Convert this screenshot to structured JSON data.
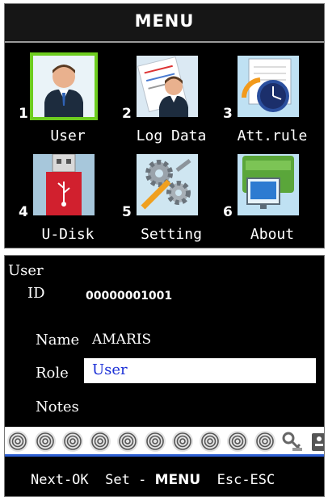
{
  "menu": {
    "title": "MENU",
    "items": [
      {
        "num": "1",
        "label": "User",
        "icon": "user-icon"
      },
      {
        "num": "2",
        "label": "Log Data",
        "icon": "log-data-icon"
      },
      {
        "num": "3",
        "label": "Att.rule",
        "icon": "attendance-rule-icon"
      },
      {
        "num": "4",
        "label": "U-Disk",
        "icon": "usb-disk-icon"
      },
      {
        "num": "5",
        "label": "Setting",
        "icon": "settings-gears-icon"
      },
      {
        "num": "6",
        "label": "About",
        "icon": "about-fingerprint-icon"
      }
    ],
    "selected_index": 0
  },
  "user_form": {
    "header": "User",
    "id_label": "ID",
    "id_value": "00000001001",
    "name_label": "Name",
    "name_value": "AMARIS",
    "role_label": "Role",
    "role_value": "User",
    "notes_label": "Notes",
    "fingerprint_slots": 10,
    "extra_icons": [
      "password-key-icon",
      "card-icon"
    ],
    "footer": {
      "next": "Next-OK",
      "set_prefix": "Set - ",
      "set_key": "MENU",
      "esc": "Esc-ESC"
    }
  },
  "colors": {
    "selection": "#6dcc1f",
    "role_text": "#1a2fd6",
    "divider": "#2d5fd3"
  }
}
